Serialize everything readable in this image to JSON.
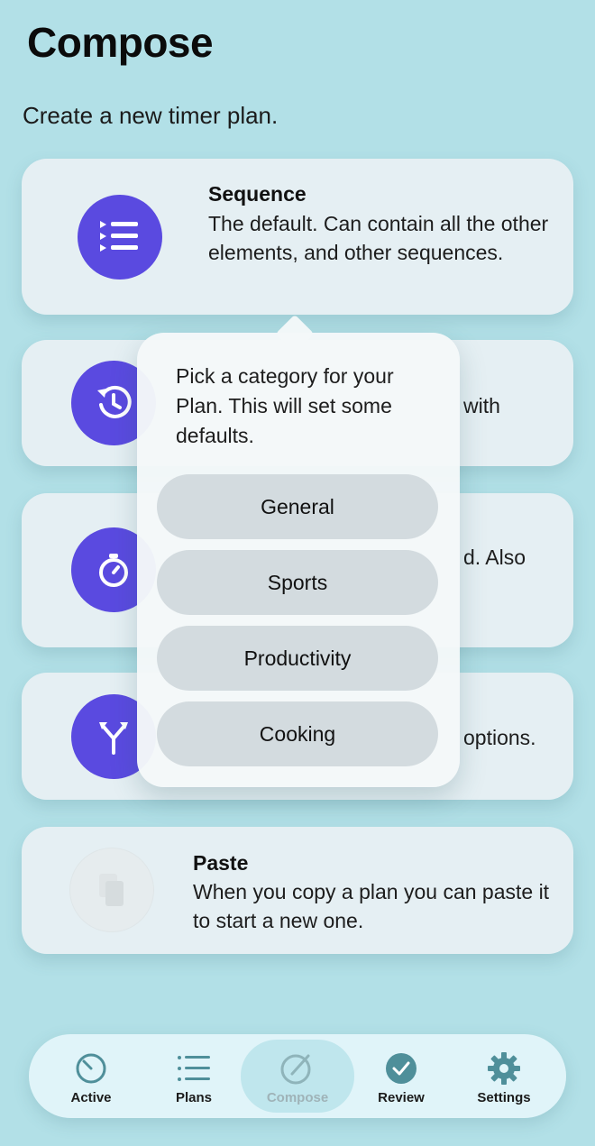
{
  "header": {
    "title": "Compose",
    "subtitle": "Create a new timer plan."
  },
  "cards": {
    "sequence": {
      "title": "Sequence",
      "description": "The default. Can contain all the other elements, and other sequences."
    },
    "card2": {
      "visible_fragment": "with"
    },
    "card3": {
      "visible_fragment": "d. Also"
    },
    "card4": {
      "visible_fragment": "options."
    },
    "paste": {
      "title": "Paste",
      "description": "When you copy a plan you can paste it to start a new one."
    }
  },
  "popover": {
    "prompt": "Pick a category for your Plan. This will set some defaults.",
    "options": [
      "General",
      "Sports",
      "Productivity",
      "Cooking"
    ]
  },
  "tabbar": {
    "tabs": [
      {
        "label": "Active",
        "icon": "timer-icon"
      },
      {
        "label": "Plans",
        "icon": "list-icon"
      },
      {
        "label": "Compose",
        "icon": "compose-icon",
        "selected": true
      },
      {
        "label": "Review",
        "icon": "checkmark-circle-icon"
      },
      {
        "label": "Settings",
        "icon": "gear-icon"
      }
    ]
  },
  "colors": {
    "background": "#b2e0e7",
    "accent": "#5a4ae0",
    "card": "#e8f0f3",
    "pill": "#d3dbdf"
  }
}
